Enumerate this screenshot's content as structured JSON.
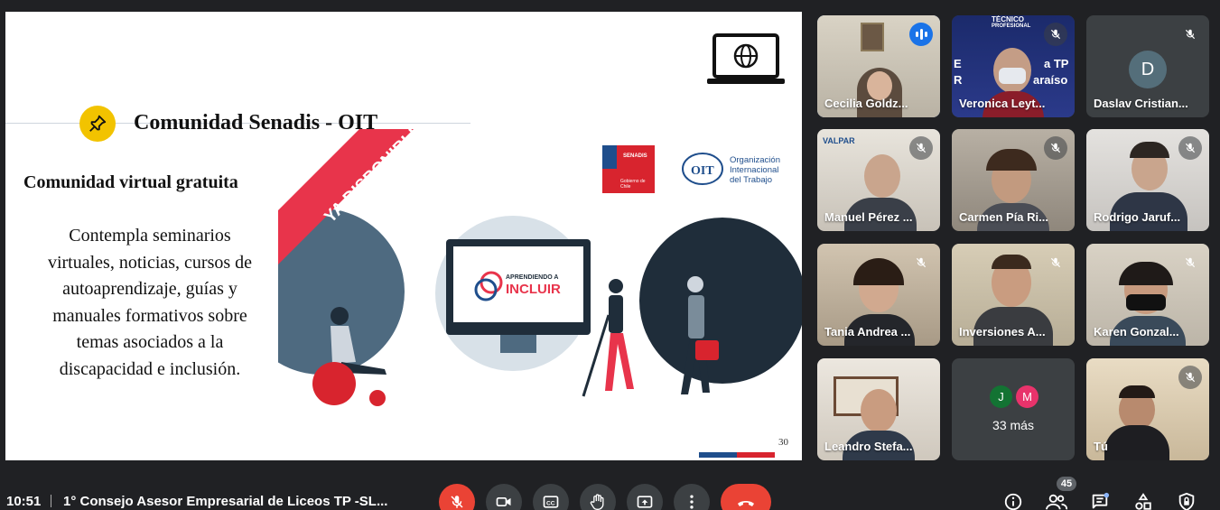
{
  "slide": {
    "title": "Comunidad Senadis - OIT",
    "subtitle": "Comunidad virtual gratuita",
    "body_lines": [
      "Contempla seminarios",
      "virtuales, noticias, cursos de",
      "autoaprendizaje, guías y",
      "manuales formativos sobre",
      "temas asociados a la",
      "discapacidad e inclusión."
    ],
    "ribbon": "YA DISPONIBLE",
    "screen_logo_top": "APRENDIENDO A",
    "screen_logo_main": "INCLUIR",
    "senadis_logo": "SENADIS",
    "senadis_sub": "Gobierno de Chile",
    "oit_logo": "OIT",
    "oit_text": [
      "Organización",
      "Internacional",
      "del Trabajo"
    ],
    "page_number": "30",
    "colors": {
      "accent_red": "#e8344b",
      "navy": "#1f2d3a",
      "slate": "#4e6a80",
      "pin_yellow": "#f2c300"
    }
  },
  "participants": [
    {
      "name": "Cecilia Goldz...",
      "speaking": true,
      "muted": false
    },
    {
      "name": "Veronica Leyt...",
      "muted": true,
      "overlay_text": [
        "TÉCNICO",
        "PROFESIONAL",
        "E",
        "a TP",
        "R",
        "araíso"
      ]
    },
    {
      "name": "Daslav Cristian...",
      "muted": true,
      "initial": "D"
    },
    {
      "name": "Manuel Pérez ...",
      "muted": true,
      "overlay_text": [
        "VALPAR"
      ]
    },
    {
      "name": "Carmen Pía Ri...",
      "muted": true
    },
    {
      "name": "Rodrigo Jaruf...",
      "muted": true
    },
    {
      "name": "Tania Andrea ...",
      "muted": true
    },
    {
      "name": "Inversiones A...",
      "muted": true
    },
    {
      "name": "Karen Gonzal...",
      "muted": true
    },
    {
      "name": "Leandro Stefa...",
      "muted": false
    },
    {
      "more": true,
      "label": "33 más",
      "initials": [
        "J",
        "M"
      ],
      "colors": [
        "#137333",
        "#e8336b"
      ]
    },
    {
      "name": "Tú",
      "muted": true
    }
  ],
  "bottom_bar": {
    "time": "10:51",
    "meeting_title": "1° Consejo Asesor Empresarial de Liceos TP -SL...",
    "participant_count": "45",
    "icons": [
      "mic-off-icon",
      "camera-icon",
      "captions-icon",
      "raise-hand-icon",
      "present-icon",
      "more-options-icon",
      "end-call-icon",
      "info-icon",
      "people-icon",
      "chat-icon",
      "activities-icon",
      "host-controls-icon"
    ]
  }
}
